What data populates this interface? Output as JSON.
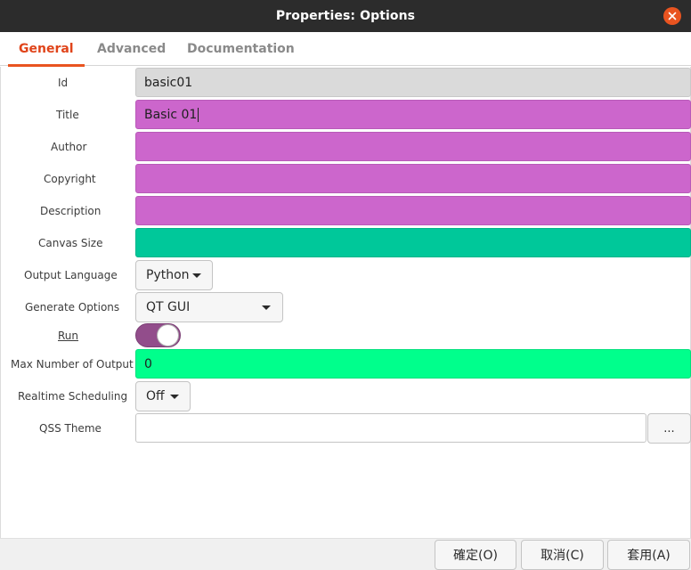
{
  "window": {
    "title": "Properties: Options"
  },
  "tabs": [
    {
      "label": "General",
      "active": true
    },
    {
      "label": "Advanced",
      "active": false
    },
    {
      "label": "Documentation",
      "active": false
    }
  ],
  "fields": {
    "id": {
      "label": "Id",
      "value": "basic01"
    },
    "title": {
      "label": "Title",
      "value": "Basic 01"
    },
    "author": {
      "label": "Author",
      "value": ""
    },
    "copyright": {
      "label": "Copyright",
      "value": ""
    },
    "description": {
      "label": "Description",
      "value": ""
    },
    "canvas_size": {
      "label": "Canvas Size",
      "value": ""
    },
    "output_language": {
      "label": "Output Language",
      "value": "Python"
    },
    "generate_options": {
      "label": "Generate Options",
      "value": "QT GUI"
    },
    "run": {
      "label": "Run",
      "value": true
    },
    "max_number_of_output": {
      "label": "Max Number of Output",
      "value": "0"
    },
    "realtime_scheduling": {
      "label": "Realtime Scheduling",
      "value": "Off"
    },
    "qss_theme": {
      "label": "QSS Theme",
      "value": "",
      "browse_label": "..."
    }
  },
  "buttons": {
    "ok": "確定(O)",
    "cancel": "取消(C)",
    "apply": "套用(A)"
  },
  "colors": {
    "accent": "#e95420",
    "field_magenta": "#cc66cc",
    "field_teal": "#00c89a",
    "field_green": "#00ff8c",
    "field_gray": "#dadada",
    "toggle_on": "#924d8b"
  }
}
